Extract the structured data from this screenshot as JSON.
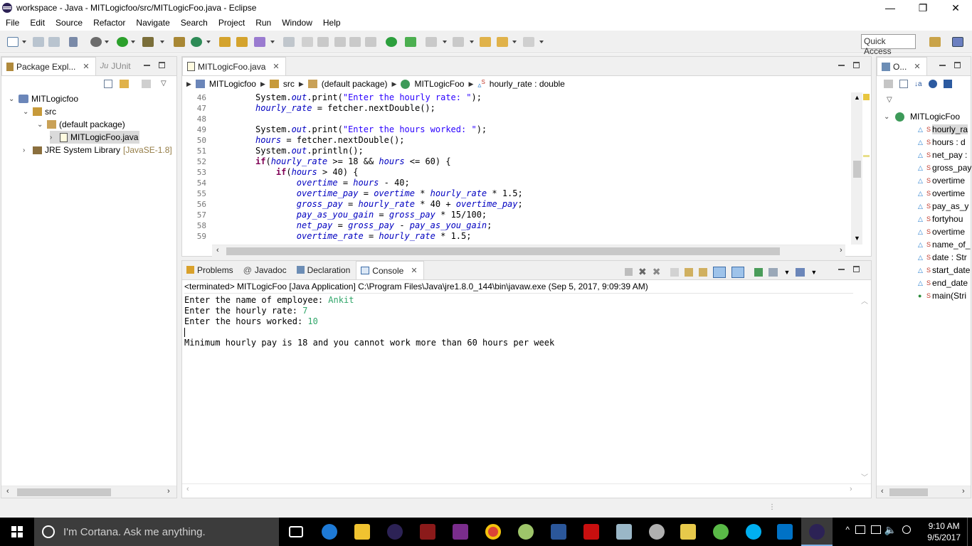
{
  "window": {
    "title": "workspace - Java - MITLogicfoo/src/MITLogicFoo.java - Eclipse",
    "minimize": "—",
    "restore": "❐",
    "close": "✕"
  },
  "menu": [
    "File",
    "Edit",
    "Source",
    "Refactor",
    "Navigate",
    "Search",
    "Project",
    "Run",
    "Window",
    "Help"
  ],
  "toolbar": {
    "quick_access_placeholder": "Quick Access"
  },
  "package_explorer": {
    "tab_label": "Package Expl...",
    "junit_tab_label": "JUnit",
    "tree": {
      "project": "MITLogicfoo",
      "src": "src",
      "package": "(default package)",
      "file": "MITLogicFoo.java",
      "jre": "JRE System Library",
      "jre_version": "[JavaSE-1.8]"
    }
  },
  "editor": {
    "tab_label": "MITLogicFoo.java",
    "breadcrumb": [
      "MITLogicfoo",
      "src",
      "(default package)",
      "MITLogicFoo",
      "hourly_rate : double"
    ],
    "line_numbers": [
      "46",
      "47",
      "48",
      "49",
      "50",
      "51",
      "52",
      "53",
      "54",
      "55",
      "56",
      "57",
      "58",
      "59"
    ]
  },
  "console": {
    "tabs": [
      "Problems",
      "Javadoc",
      "Declaration",
      "Console"
    ],
    "terminated_line": "<terminated> MITLogicFoo [Java Application] C:\\Program Files\\Java\\jre1.8.0_144\\bin\\javaw.exe (Sep 5, 2017, 9:09:39 AM)",
    "lines": [
      {
        "prompt": "Enter the name of employee: ",
        "input": "Ankit"
      },
      {
        "prompt": "Enter the hourly rate: ",
        "input": "7"
      },
      {
        "prompt": "Enter the hours worked: ",
        "input": "10"
      }
    ],
    "message": "Minimum hourly pay is 18 and you cannot work more than 60 hours per week"
  },
  "outline": {
    "tab_label": "O...",
    "class_name": "MITLogicFoo",
    "members": [
      "hourly_ra",
      "hours : d",
      "net_pay :",
      "gross_pay",
      "overtime",
      "overtime",
      "pay_as_y",
      "fortyhou",
      "overtime",
      "name_of_",
      "date : Str",
      "start_date",
      "end_date",
      "main(Stri"
    ]
  },
  "taskbar": {
    "cortana_placeholder": "I'm Cortana. Ask me anything.",
    "time": "9:10 AM",
    "date": "9/5/2017"
  }
}
